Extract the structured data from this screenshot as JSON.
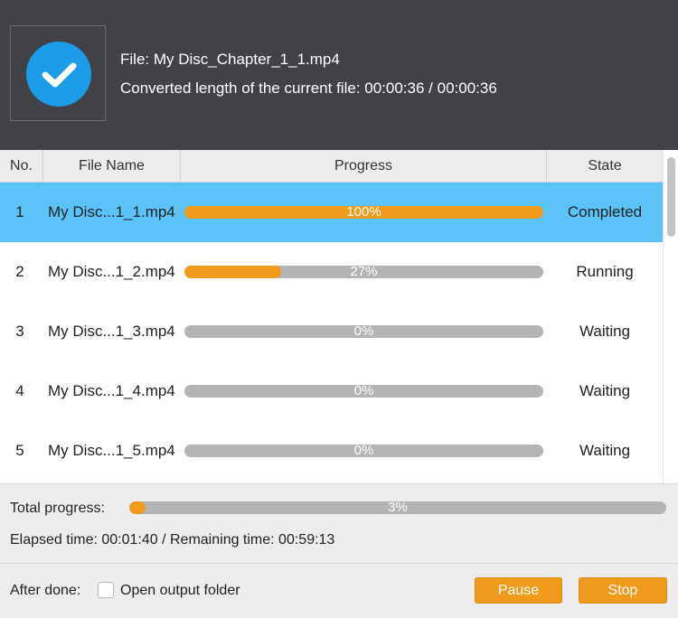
{
  "current": {
    "file_line": "File: My Disc_Chapter_1_1.mp4",
    "length_line": "Converted length of the current file: 00:00:36 / 00:00:36"
  },
  "columns": {
    "no": "No.",
    "name": "File Name",
    "progress": "Progress",
    "state": "State"
  },
  "rows": [
    {
      "no": "1",
      "name": "My Disc...1_1.mp4",
      "progress": 100,
      "progress_label": "100%",
      "state": "Completed",
      "selected": true
    },
    {
      "no": "2",
      "name": "My Disc...1_2.mp4",
      "progress": 27,
      "progress_label": "27%",
      "state": "Running",
      "selected": false
    },
    {
      "no": "3",
      "name": "My Disc...1_3.mp4",
      "progress": 0,
      "progress_label": "0%",
      "state": "Waiting",
      "selected": false
    },
    {
      "no": "4",
      "name": "My Disc...1_4.mp4",
      "progress": 0,
      "progress_label": "0%",
      "state": "Waiting",
      "selected": false
    },
    {
      "no": "5",
      "name": "My Disc...1_5.mp4",
      "progress": 0,
      "progress_label": "0%",
      "state": "Waiting",
      "selected": false
    }
  ],
  "total": {
    "label": "Total progress:",
    "progress": 3,
    "progress_label": "3%",
    "elapsed_line": "Elapsed time: 00:01:40 / Remaining time: 00:59:13"
  },
  "footer": {
    "after_done_label": "After done:",
    "open_folder_label": "Open output folder",
    "open_folder_checked": false,
    "pause_label": "Pause",
    "stop_label": "Stop"
  },
  "colors": {
    "header_bg": "#414247",
    "selected_row": "#5cc3f8",
    "accent_orange": "#ef9a1a",
    "check_blue": "#1b9be8",
    "bar_track": "#b4b4b4"
  },
  "icons": {
    "status": "checkmark-circle-icon"
  }
}
